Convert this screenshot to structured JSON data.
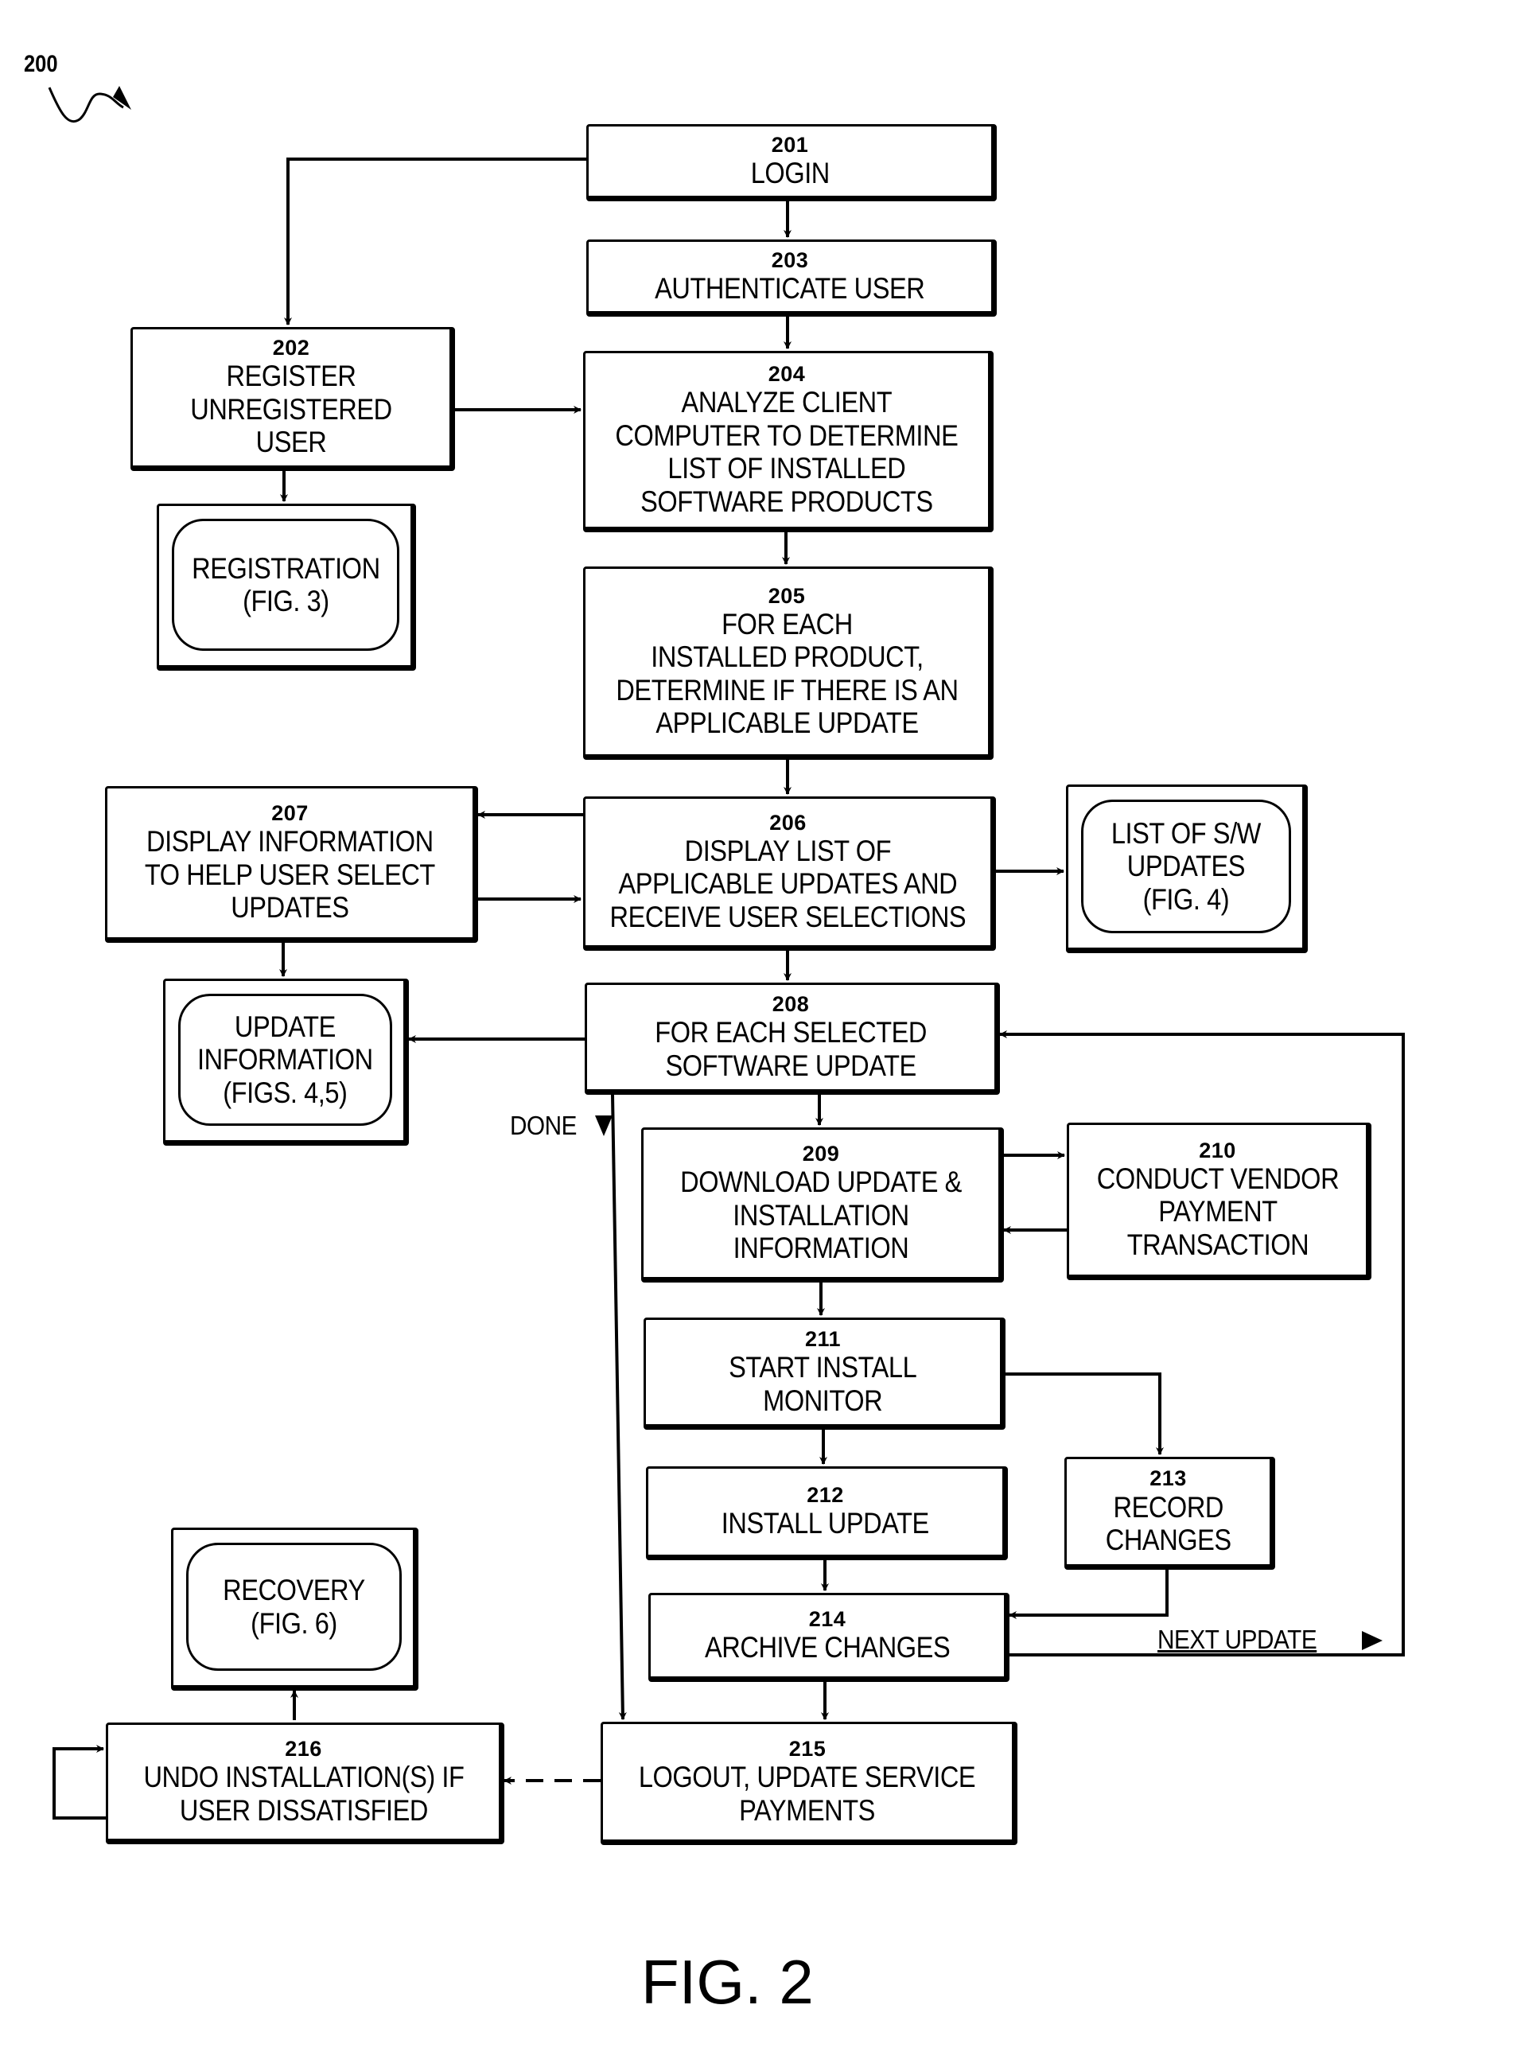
{
  "figure": {
    "ref_number": "200",
    "caption": "FIG. 2"
  },
  "steps": {
    "s201": {
      "number": "201",
      "lines": [
        "LOGIN"
      ]
    },
    "s202": {
      "number": "202",
      "lines": [
        "REGISTER",
        "UNREGISTERED",
        "USER"
      ]
    },
    "s203": {
      "number": "203",
      "lines": [
        "AUTHENTICATE USER"
      ]
    },
    "s204": {
      "number": "204",
      "lines": [
        "ANALYZE CLIENT",
        "COMPUTER TO DETERMINE",
        "LIST OF INSTALLED",
        "SOFTWARE PRODUCTS"
      ]
    },
    "s205": {
      "number": "205",
      "lines": [
        "FOR EACH",
        "INSTALLED PRODUCT,",
        "DETERMINE IF THERE IS AN",
        "APPLICABLE UPDATE"
      ]
    },
    "s206": {
      "number": "206",
      "lines": [
        "DISPLAY LIST OF",
        "APPLICABLE UPDATES AND",
        "RECEIVE USER SELECTIONS"
      ]
    },
    "s207": {
      "number": "207",
      "lines": [
        "DISPLAY INFORMATION",
        "TO HELP USER SELECT",
        "UPDATES"
      ]
    },
    "s208": {
      "number": "208",
      "lines": [
        "FOR EACH SELECTED",
        "SOFTWARE UPDATE"
      ]
    },
    "s209": {
      "number": "209",
      "lines": [
        "DOWNLOAD UPDATE &",
        "INSTALLATION",
        "INFORMATION"
      ]
    },
    "s210": {
      "number": "210",
      "lines": [
        "CONDUCT VENDOR",
        "PAYMENT",
        "TRANSACTION"
      ]
    },
    "s211": {
      "number": "211",
      "lines": [
        "START INSTALL",
        "MONITOR"
      ]
    },
    "s212": {
      "number": "212",
      "lines": [
        "INSTALL UPDATE"
      ]
    },
    "s213": {
      "number": "213",
      "lines": [
        "RECORD",
        "CHANGES"
      ]
    },
    "s214": {
      "number": "214",
      "lines": [
        "ARCHIVE CHANGES"
      ]
    },
    "s215": {
      "number": "215",
      "lines": [
        "LOGOUT, UPDATE SERVICE",
        "PAYMENTS"
      ]
    },
    "s216": {
      "number": "216",
      "lines": [
        "UNDO INSTALLATION(S) IF",
        "USER DISSATISFIED"
      ]
    }
  },
  "screens": {
    "registration": {
      "lines": [
        "REGISTRATION",
        "(FIG. 3)"
      ]
    },
    "sw_updates": {
      "lines": [
        "LIST OF S/W",
        "UPDATES",
        "(FIG. 4)"
      ]
    },
    "update_info": {
      "lines": [
        "UPDATE",
        "INFORMATION",
        "(FIGS. 4,5)"
      ]
    },
    "recovery": {
      "lines": [
        "RECOVERY",
        "(FIG. 6)"
      ]
    }
  },
  "edge_labels": {
    "done": "DONE",
    "next_update": "NEXT UPDATE"
  }
}
